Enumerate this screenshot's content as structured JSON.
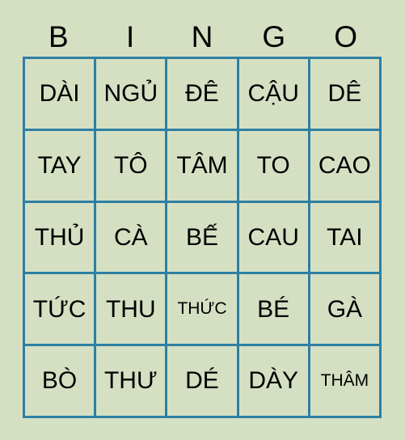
{
  "card": {
    "type": "bingo-card",
    "background_color": "#d5e0c3",
    "grid_line_color": "#2e7fa3",
    "text_color": "#000000",
    "header": {
      "letters": [
        "B",
        "I",
        "N",
        "G",
        "O"
      ]
    },
    "rows": [
      [
        {
          "text": "DÀI",
          "size": "normal"
        },
        {
          "text": "NGỦ",
          "size": "normal"
        },
        {
          "text": "ĐÊ",
          "size": "normal"
        },
        {
          "text": "CẬU",
          "size": "normal"
        },
        {
          "text": "DÊ",
          "size": "normal"
        }
      ],
      [
        {
          "text": "TAY",
          "size": "normal"
        },
        {
          "text": "TÔ",
          "size": "normal"
        },
        {
          "text": "TÂM",
          "size": "normal"
        },
        {
          "text": "TO",
          "size": "normal"
        },
        {
          "text": "CAO",
          "size": "normal"
        }
      ],
      [
        {
          "text": "THỦ",
          "size": "normal"
        },
        {
          "text": "CÀ",
          "size": "normal"
        },
        {
          "text": "BẾ",
          "size": "normal"
        },
        {
          "text": "CAU",
          "size": "normal"
        },
        {
          "text": "TAI",
          "size": "normal"
        }
      ],
      [
        {
          "text": "TỨC",
          "size": "normal"
        },
        {
          "text": "THU",
          "size": "normal"
        },
        {
          "text": "THỨC",
          "size": "small"
        },
        {
          "text": "BÉ",
          "size": "normal"
        },
        {
          "text": "GÀ",
          "size": "normal"
        }
      ],
      [
        {
          "text": "BÒ",
          "size": "normal"
        },
        {
          "text": "THƯ",
          "size": "normal"
        },
        {
          "text": "DÉ",
          "size": "normal"
        },
        {
          "text": "DÀY",
          "size": "normal"
        },
        {
          "text": "THÂM",
          "size": "small"
        }
      ]
    ]
  }
}
